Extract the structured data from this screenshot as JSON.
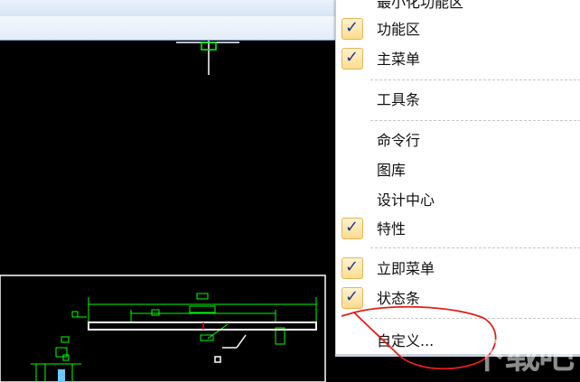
{
  "menu": {
    "items": [
      {
        "label": "最小化功能区",
        "checked": false
      },
      {
        "label": "功能区",
        "checked": true
      },
      {
        "label": "主菜单",
        "checked": true
      },
      {
        "label": "工具条",
        "checked": false
      },
      {
        "label": "命令行",
        "checked": false
      },
      {
        "label": "图库",
        "checked": false
      },
      {
        "label": "设计中心",
        "checked": false
      },
      {
        "label": "特性",
        "checked": true
      },
      {
        "label": "立即菜单",
        "checked": true
      },
      {
        "label": "状态条",
        "checked": true
      },
      {
        "label": "自定义...",
        "checked": false
      }
    ]
  },
  "watermark": "下载吧",
  "colors": {
    "cad_background": "#000000",
    "cad_green": "#00ff00",
    "cad_white": "#ffffff",
    "annotation_red": "#e0201c",
    "checkbox_fill": "#fbdc8e"
  },
  "icons": {
    "check": "check-icon"
  }
}
